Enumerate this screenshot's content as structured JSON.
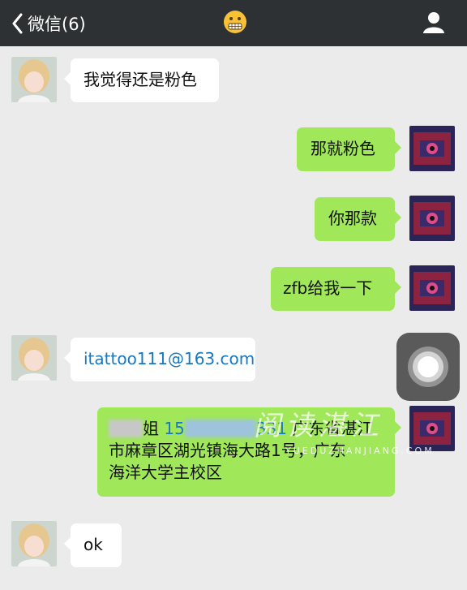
{
  "header": {
    "back_label": "微信(6)"
  },
  "messages": [
    {
      "side": "in",
      "text": "我觉得还是粉色"
    },
    {
      "side": "out",
      "text": "那就粉色"
    },
    {
      "side": "out",
      "text": "你那款"
    },
    {
      "side": "out",
      "text": "zfb给我一下"
    },
    {
      "side": "in",
      "text": "itattoo111@163.com"
    },
    {
      "side": "out",
      "name_tail": "姐",
      "phone_head": "15",
      "phone_tail": "331",
      "line1_tail": "广东省湛江",
      "line2": "市麻章区湖光镇海大路1号，广东",
      "line3": "海洋大学主校区"
    },
    {
      "side": "in",
      "text": "ok"
    }
  ],
  "watermark": {
    "text": "阅读湛江",
    "url": "YUEDUZHANJIANG.COM"
  },
  "colors": {
    "topbar": "#2e3133",
    "background": "#ebebeb",
    "bubble_out": "#a0e75a",
    "bubble_in": "#ffffff",
    "link": "#1778c3"
  }
}
